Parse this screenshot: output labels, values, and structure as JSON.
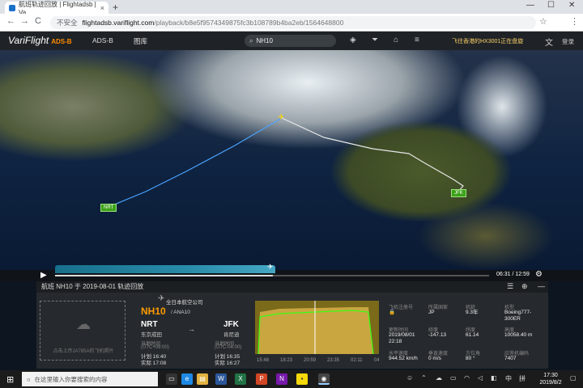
{
  "browser": {
    "tab_title": "航班轨迹回放 | Flightadsb | Va...",
    "tab_close": "×",
    "new_tab": "+",
    "win_min": "—",
    "win_max": "☐",
    "win_close": "✕",
    "back": "←",
    "forward": "→",
    "reload": "C",
    "insecure_label": "不安全",
    "url_domain": "flightadsb.variflight.com",
    "url_path": "/playback/b8e5f9574349875fc3b108789b4ba2eb/1564648800",
    "star": "☆",
    "menu": "⋮"
  },
  "header": {
    "logo_text": "VariFlight",
    "logo_badge": "ADS-B",
    "nav": [
      "ADS-B",
      "图库"
    ],
    "search_value": "NH10",
    "notice": "飞往香港的HX3001正在盘旋",
    "login": "登录"
  },
  "map": {
    "origin_label": "NRT",
    "dest_label": "JFK",
    "route_colors": {
      "flown": "#4aa3ff",
      "planned": "#dddddd"
    }
  },
  "playback": {
    "time": "06:31 / 12:59",
    "progress": 0.502
  },
  "panel": {
    "title": "航班 NH10 于 2019-08-01 轨迹回放",
    "photo_text": "点击上传JA785A的飞机照片",
    "airline": "全日本航空公司",
    "flight_no": "NH10",
    "flight_alt": "/ ANA10",
    "origin": {
      "code": "NRT",
      "name": "东京成田",
      "tz_label": "当地时间",
      "tz": "(UTC+09:00)",
      "sched": "计划 16:40",
      "actual": "实际 17:08"
    },
    "dest": {
      "code": "JFK",
      "name": "肯尼迪",
      "tz_label": "当地时间",
      "tz": "(UTC-04:00)",
      "sched": "计划 16:35",
      "actual": "实际 16:27"
    },
    "arrow": "→",
    "chart_times": [
      "15:48",
      "18:23",
      "20:59",
      "23:35",
      "02:11",
      "04:47"
    ],
    "fields": [
      {
        "label": "飞机注册号",
        "value": "🔒"
      },
      {
        "label": "所属国家",
        "value": "JP"
      },
      {
        "label": "机龄",
        "value": "9.3年"
      },
      {
        "label": "机型",
        "value": "Boeing777-300ER"
      },
      {
        "label": "更新时间",
        "value": "2019/08/01 22:18"
      },
      {
        "label": "经度",
        "value": "-147.13"
      },
      {
        "label": "纬度",
        "value": "61.14"
      },
      {
        "label": "高度",
        "value": "10058.40 m"
      },
      {
        "label": "水平速度",
        "value": "944.52 km/h"
      },
      {
        "label": "垂直速度",
        "value": "0 m/s"
      },
      {
        "label": "方位角",
        "value": "80 °"
      },
      {
        "label": "应答机编码",
        "value": "7407"
      }
    ]
  },
  "taskbar": {
    "search_placeholder": "在这里输入你要搜索的内容",
    "ime": "中",
    "time": "17:30",
    "date": "2019/8/2"
  }
}
